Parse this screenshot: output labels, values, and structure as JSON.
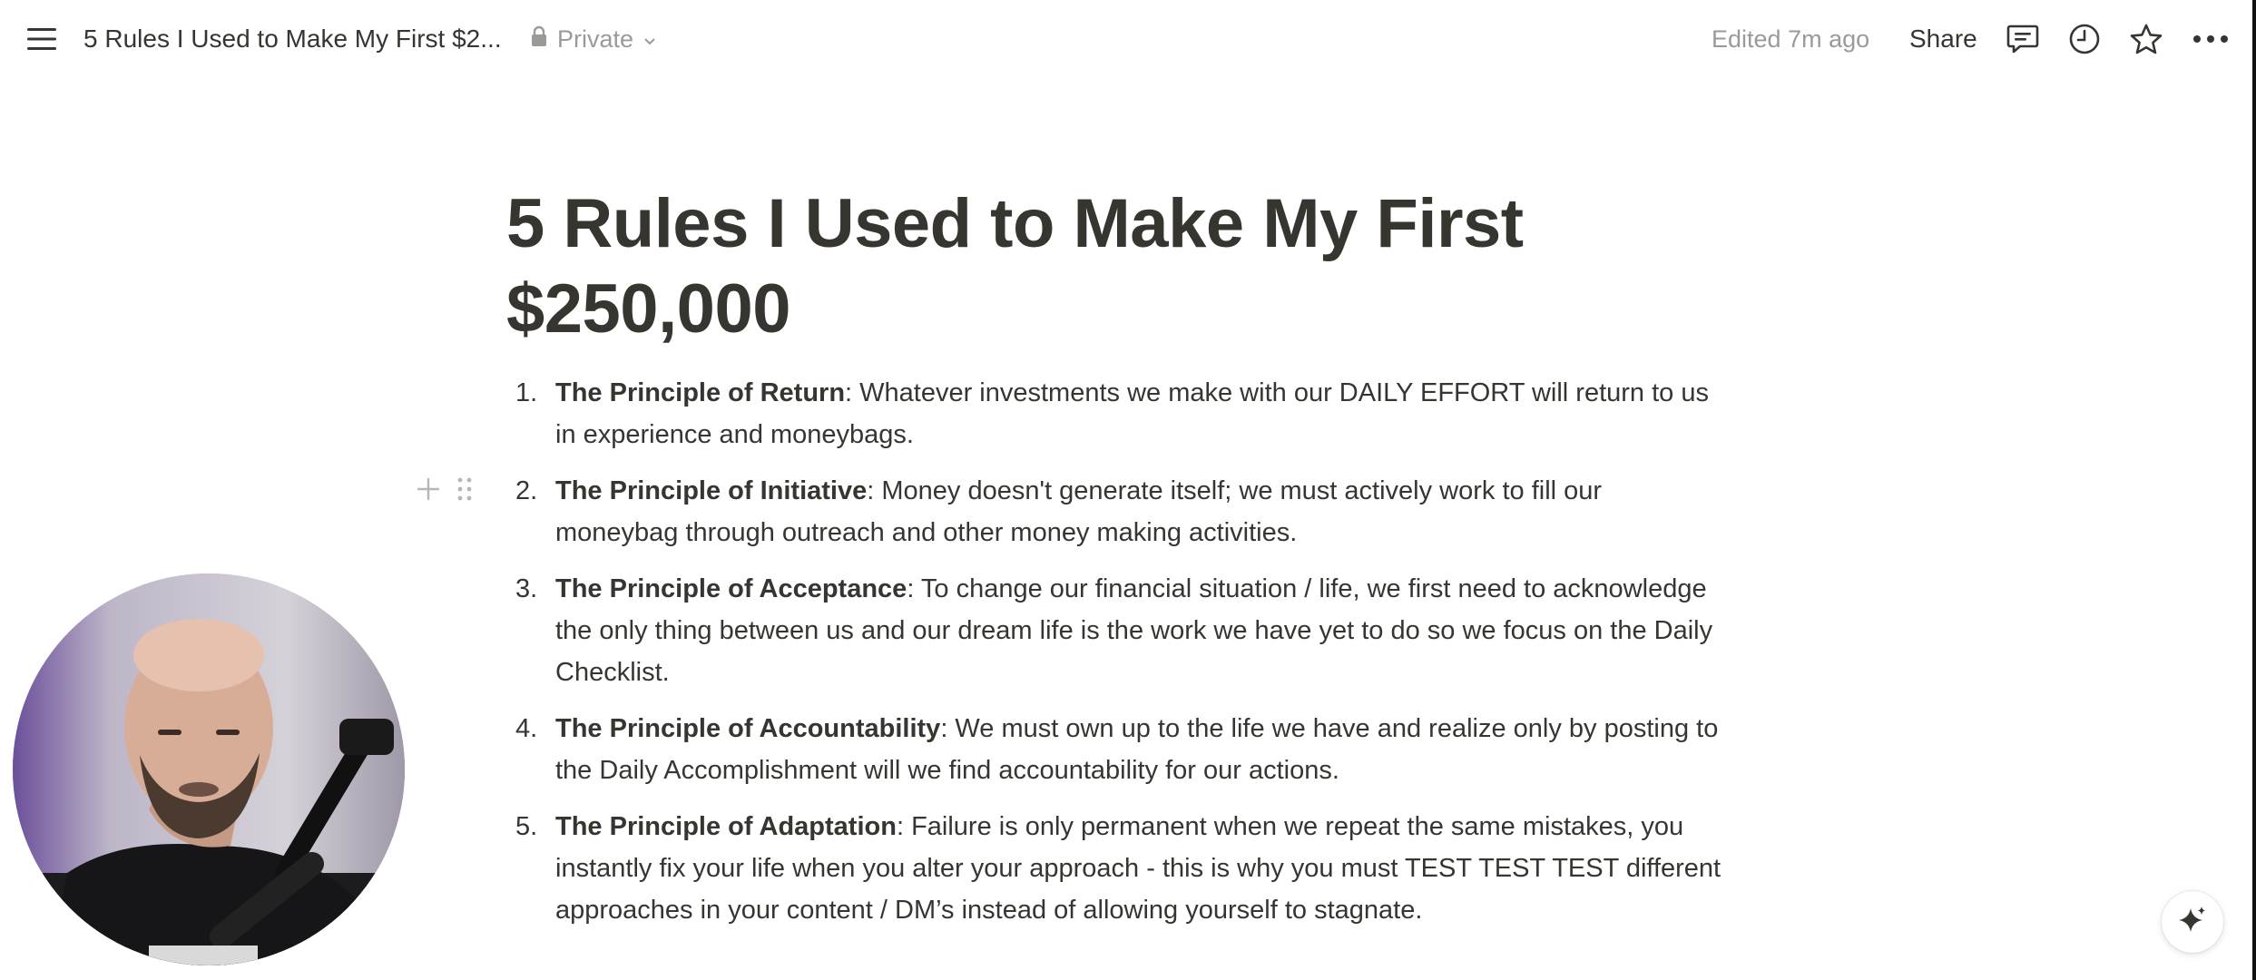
{
  "topbar": {
    "doc_title": "5 Rules I Used to Make My First $2...",
    "privacy_label": "Private",
    "edited_label": "Edited 7m ago",
    "share_label": "Share"
  },
  "icons": {
    "menu": "menu-icon",
    "lock": "lock-icon",
    "chevron": "chevron-down-icon",
    "comments": "comment-icon",
    "history": "clock-icon",
    "favorite": "star-icon",
    "more": "more-icon",
    "add_block": "plus-icon",
    "drag": "drag-handle-icon",
    "ai": "sparkle-icon"
  },
  "page": {
    "title": "5 Rules I Used to Make My First $250,000",
    "rules": [
      {
        "number": "1.",
        "name": "The Principle of Return",
        "body": ": Whatever investments we make with our DAILY EFFORT will return to us in experience and moneybags."
      },
      {
        "number": "2.",
        "name": "The Principle of Initiative",
        "body": ": Money doesn't generate itself; we must actively work to fill our moneybag through outreach and other money making activities."
      },
      {
        "number": "3.",
        "name": "The Principle of Acceptance",
        "body": ": To change our financial situation / life, we first need to acknowledge the only thing between us and our dream life is the work we have yet to do so we focus on the Daily Checklist."
      },
      {
        "number": "4.",
        "name": "The Principle of Accountability",
        "body": ": We must own up to the life we have and realize only by posting to the Daily Accomplishment will we find accountability for our actions."
      },
      {
        "number": "5.",
        "name": "The Principle of Adaptation",
        "body": ": Failure is only permanent when we repeat the same mistakes, you instantly fix your life when you alter your approach - this is why you must TEST TEST TEST different approaches in your content / DM’s instead of allowing yourself to stagnate."
      }
    ]
  },
  "colors": {
    "text": "#37352f",
    "muted": "#9b9a97"
  }
}
